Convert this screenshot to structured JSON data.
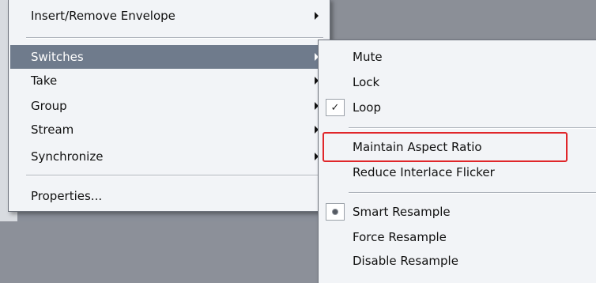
{
  "main_menu": {
    "items": [
      {
        "label": "Insert/Remove Envelope"
      },
      {
        "label": "Switches"
      },
      {
        "label": "Take"
      },
      {
        "label": "Group"
      },
      {
        "label": "Stream"
      },
      {
        "label": "Synchronize"
      },
      {
        "label": "Properties..."
      }
    ]
  },
  "sub_menu": {
    "items": [
      {
        "label": "Mute"
      },
      {
        "label": "Lock"
      },
      {
        "label": "Loop",
        "checked": true,
        "check_glyph": "✓"
      },
      {
        "label": "Maintain Aspect Ratio"
      },
      {
        "label": "Reduce Interlace Flicker"
      },
      {
        "label": "Smart Resample",
        "radio_selected": true
      },
      {
        "label": "Force Resample"
      },
      {
        "label": "Disable Resample"
      }
    ]
  },
  "highlight_color": "#6f7b8c",
  "annotation_color": "#e0262a"
}
